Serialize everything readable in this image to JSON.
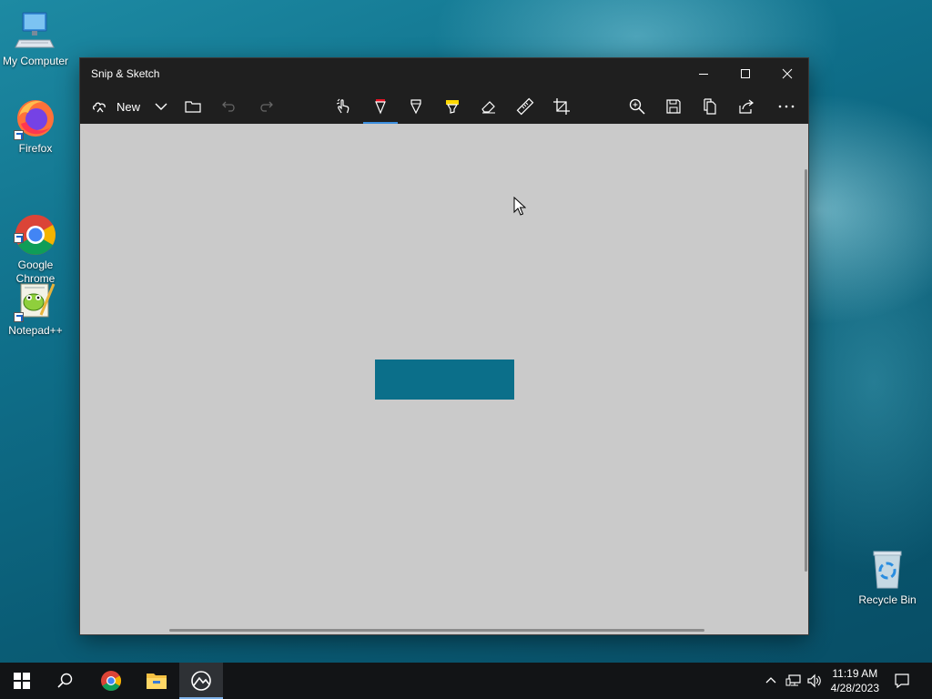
{
  "desktop": {
    "icons": [
      {
        "label": "My Computer",
        "icon": "computer-icon"
      },
      {
        "label": "Firefox",
        "icon": "firefox-icon"
      },
      {
        "label": "Google\nChrome",
        "icon": "chrome-icon"
      },
      {
        "label": "Notepad++",
        "icon": "notepadpp-icon"
      },
      {
        "label": "Recycle Bin",
        "icon": "recycle-bin-icon"
      }
    ]
  },
  "window": {
    "title": "Snip & Sketch",
    "toolbar": {
      "new_label": "New"
    },
    "snip_color": "#0b6f8a"
  },
  "taskbar": {
    "time": "11:19 AM",
    "date": "4/28/2023"
  },
  "colors": {
    "titlebar": "#1f1f1f",
    "canvas": "#cacaca",
    "taskbar": "#121416",
    "accent": "#3b8ede"
  }
}
